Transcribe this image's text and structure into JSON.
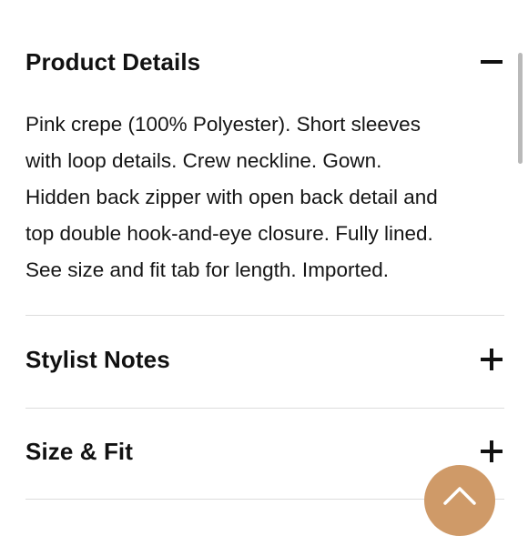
{
  "accordion": {
    "sections": [
      {
        "title": "Product Details",
        "state": "expanded",
        "toggle_icon": "minus-icon",
        "description_lines": [
          "Pink crepe (100% Polyester). Short sleeves",
          "with loop details. Crew neckline. Gown.",
          "Hidden back zipper with open back detail and",
          "top double hook-and-eye closure. Fully lined.",
          "See size and fit tab for length. Imported."
        ]
      },
      {
        "title": "Stylist Notes",
        "state": "collapsed",
        "toggle_icon": "plus-icon"
      },
      {
        "title": "Size & Fit",
        "state": "collapsed",
        "toggle_icon": "plus-icon"
      }
    ]
  },
  "back_to_top": {
    "icon": "chevron-up-icon",
    "color": "#cf9a68"
  },
  "colors": {
    "text": "#111111",
    "divider": "#dcdcdc",
    "scrollbar": "#b9b9b9",
    "accent": "#cf9a68"
  }
}
